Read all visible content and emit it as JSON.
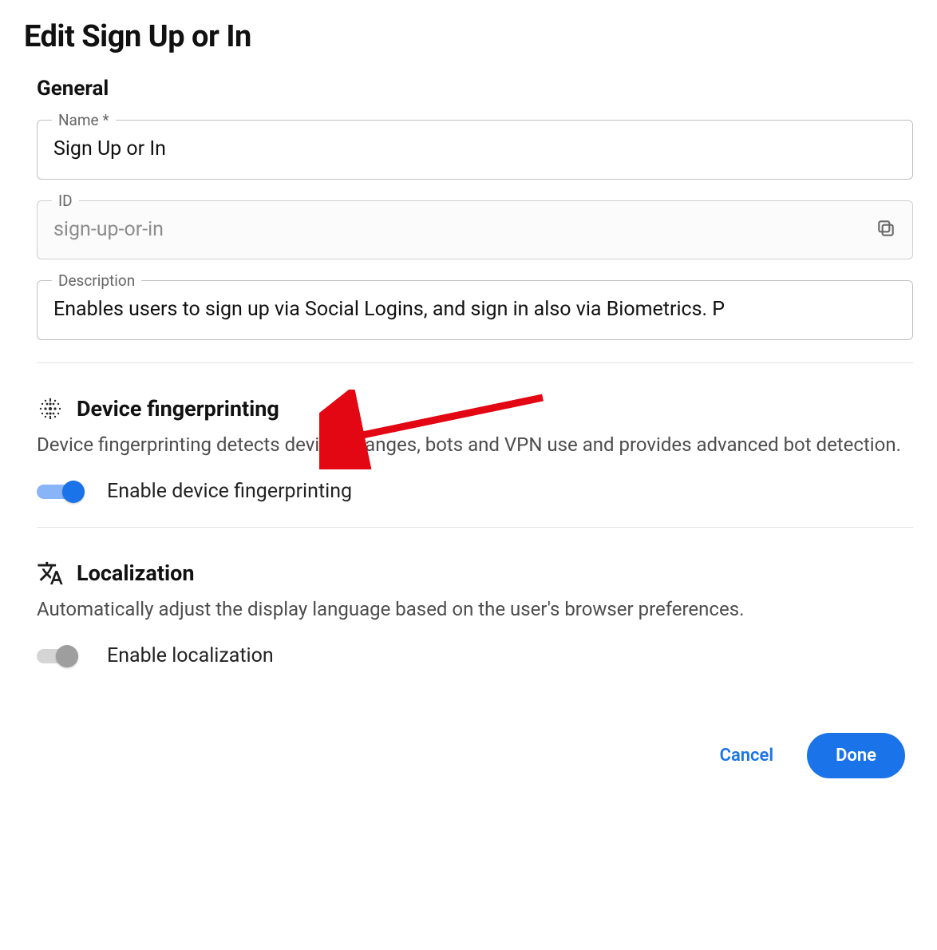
{
  "page": {
    "title": "Edit Sign Up or In"
  },
  "general": {
    "heading": "General",
    "name_label": "Name *",
    "name_value": "Sign Up or In",
    "id_label": "ID",
    "id_value": "sign-up-or-in",
    "description_label": "Description",
    "description_value": "Enables users to sign up via Social Logins, and sign in also via Biometrics. P"
  },
  "fingerprinting": {
    "title": "Device fingerprinting",
    "description": "Device fingerprinting detects device changes, bots and VPN use and provides advanced bot detection.",
    "toggle_label": "Enable device fingerprinting",
    "enabled": true
  },
  "localization": {
    "title": "Localization",
    "description": "Automatically adjust the display language based on the user's browser preferences.",
    "toggle_label": "Enable localization",
    "enabled": false
  },
  "footer": {
    "cancel": "Cancel",
    "done": "Done"
  },
  "colors": {
    "accent": "#1a73e8",
    "arrow": "#e30613"
  }
}
